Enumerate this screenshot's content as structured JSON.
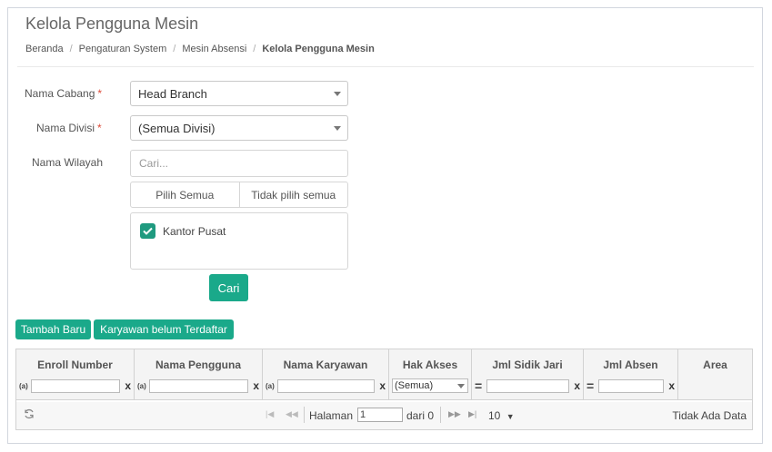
{
  "page": {
    "title": "Kelola Pengguna Mesin"
  },
  "breadcrumb": {
    "items": [
      "Beranda",
      "Pengaturan System",
      "Mesin Absensi"
    ],
    "active": "Kelola Pengguna Mesin",
    "separator": "/"
  },
  "form": {
    "cabang": {
      "label": "Nama Cabang",
      "required_mark": "*",
      "value": "Head Branch"
    },
    "divisi": {
      "label": "Nama Divisi",
      "required_mark": "*",
      "value": "(Semua Divisi)"
    },
    "wilayah": {
      "label": "Nama Wilayah",
      "search_placeholder": "Cari...",
      "select_all": "Pilih Semua",
      "deselect_all": "Tidak pilih semua",
      "options": [
        {
          "label": "Kantor Pusat",
          "checked": true
        }
      ]
    },
    "search_button": "Cari"
  },
  "toolbar": {
    "add_button": "Tambah Baru",
    "unregistered_button": "Karyawan belum Terdaftar"
  },
  "grid": {
    "columns": [
      "Enroll Number",
      "Nama Pengguna",
      "Nama Karyawan",
      "Hak Akses",
      "Jml Sidik Jari",
      "Jml Absen",
      "Area"
    ],
    "filters": {
      "text_op_icon": "(a)",
      "eq_op": "=",
      "clear": "x",
      "hak_akses_value": "(Semua)"
    },
    "pager": {
      "page_label": "Halaman",
      "page_value": "1",
      "of_label": "dari 0",
      "page_size": "10",
      "no_data": "Tidak Ada Data"
    }
  },
  "colors": {
    "accent": "#1aa98a",
    "check": "#1f9a7f",
    "required": "#dd4b39"
  }
}
